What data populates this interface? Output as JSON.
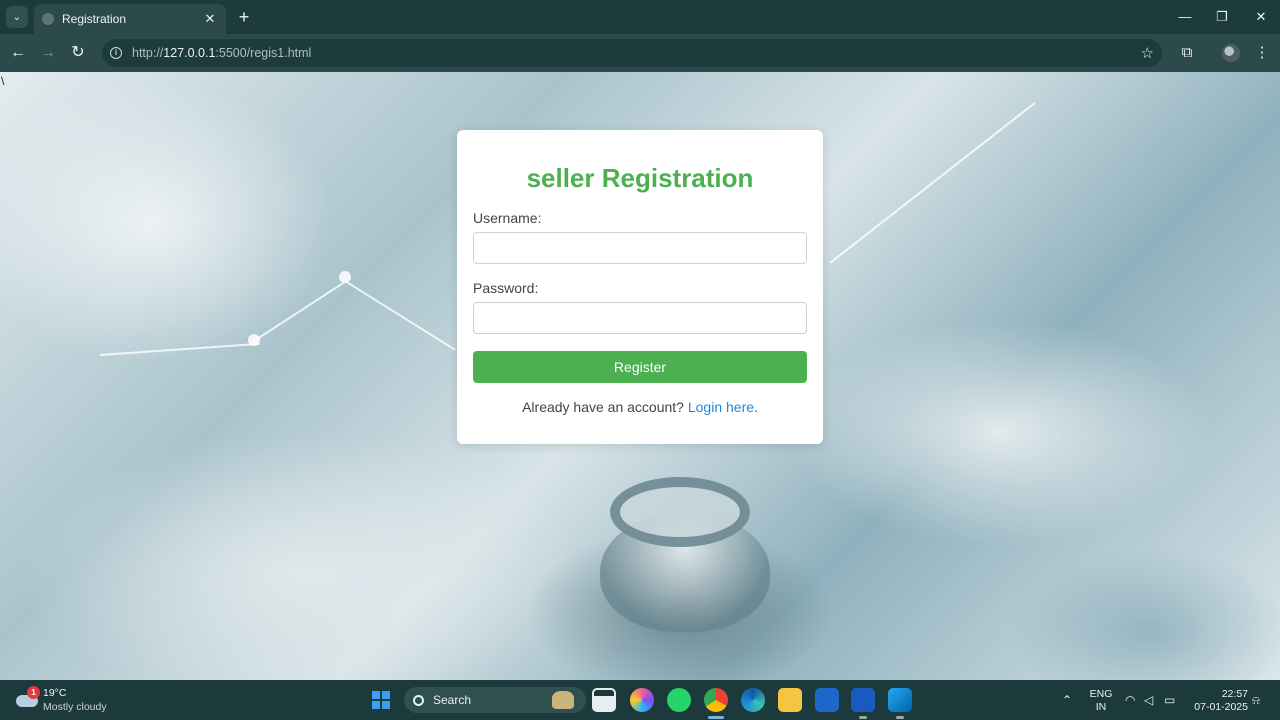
{
  "browser": {
    "tab_title": "Registration",
    "tab_close": "✕",
    "new_tab": "+",
    "tab_menu": "⌄",
    "url_scheme_host": "http://",
    "url_host": "127.0.0.1",
    "url_path": ":5500/regis1.html",
    "window_controls": {
      "minimize": "—",
      "maximize": "❐",
      "close": "✕"
    },
    "nav": {
      "back": "←",
      "forward": "→",
      "reload": "↻"
    },
    "star": "☆",
    "extensions": "⧉",
    "menu": "⋮"
  },
  "page": {
    "stray_glyph": "\\",
    "form": {
      "title": "seller Registration",
      "username_label": "Username:",
      "username_value": "",
      "password_label": "Password:",
      "password_value": "",
      "register_button": "Register",
      "login_prompt": "Already have an account? ",
      "login_link": "Login here",
      "login_suffix": ".",
      "colors": {
        "accent": "#4caf50",
        "link": "#1e88e5"
      }
    }
  },
  "taskbar": {
    "weather": {
      "badge": "1",
      "temp": "19°C",
      "desc": "Mostly cloudy"
    },
    "search_placeholder": "Search",
    "tray": {
      "chevron": "⌃",
      "lang_line1": "ENG",
      "lang_line2": "IN",
      "time": "22:57",
      "date": "07-01-2025"
    }
  }
}
